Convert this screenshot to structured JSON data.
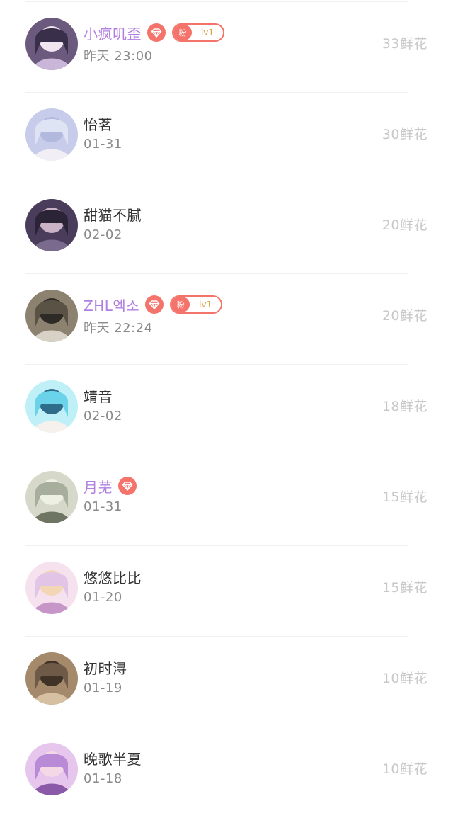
{
  "rows": [
    {
      "name": "小疯叽歪",
      "vip": true,
      "fan_badge": {
        "label": "粉",
        "level": "lv1"
      },
      "date": "昨天 23:00",
      "gift": "33鲜花",
      "avatar_icon": "anime-avatar-icon",
      "colors": [
        "#3a2f4a",
        "#6b5a7e",
        "#c9b6d8",
        "#f1e6f0"
      ]
    },
    {
      "name": "怡茗",
      "vip": false,
      "fan_badge": null,
      "date": "01-31",
      "gift": "30鲜花",
      "avatar_icon": "anime-avatar-icon",
      "colors": [
        "#dfe4f4",
        "#c6cce9",
        "#f2eef6",
        "#b2b9df"
      ]
    },
    {
      "name": "甜猫不腻",
      "vip": false,
      "fan_badge": null,
      "date": "02-02",
      "gift": "20鲜花",
      "avatar_icon": "anime-avatar-icon",
      "colors": [
        "#2b2436",
        "#4a3d5c",
        "#7a6a8e",
        "#cbb3c6"
      ]
    },
    {
      "name": "ZHL엑소",
      "vip": true,
      "fan_badge": {
        "label": "粉",
        "level": "lv1"
      },
      "date": "昨天 22:24",
      "gift": "20鲜花",
      "avatar_icon": "anime-avatar-icon",
      "colors": [
        "#5b5246",
        "#8d8270",
        "#d8d2c6",
        "#2e2a26"
      ]
    },
    {
      "name": "靖音",
      "vip": false,
      "fan_badge": null,
      "date": "02-02",
      "gift": "18鲜花",
      "avatar_icon": "anime-avatar-icon",
      "colors": [
        "#6ad3ea",
        "#bff0f8",
        "#f6f1ec",
        "#2e6c8a"
      ]
    },
    {
      "name": "月芜",
      "vip": true,
      "fan_badge": null,
      "date": "01-31",
      "gift": "15鲜花",
      "avatar_icon": "anime-avatar-icon",
      "colors": [
        "#a8ae9c",
        "#d6d9c9",
        "#6f7563",
        "#eef0e4"
      ]
    },
    {
      "name": "悠悠比比",
      "vip": false,
      "fan_badge": null,
      "date": "01-20",
      "gift": "15鲜花",
      "avatar_icon": "anime-avatar-icon",
      "colors": [
        "#e2c4e6",
        "#f6e2ef",
        "#c796c9",
        "#f3d6b4"
      ]
    },
    {
      "name": "初时浔",
      "vip": false,
      "fan_badge": null,
      "date": "01-19",
      "gift": "10鲜花",
      "avatar_icon": "portrait-avatar-icon",
      "colors": [
        "#6e5a46",
        "#a48a6a",
        "#d5c1a2",
        "#3f3226"
      ]
    },
    {
      "name": "晚歌半夏",
      "vip": false,
      "fan_badge": null,
      "date": "01-18",
      "gift": "10鲜花",
      "avatar_icon": "anime-avatar-icon",
      "colors": [
        "#b98ad6",
        "#e7c6ee",
        "#8a5aa8",
        "#f4d8e6"
      ]
    }
  ]
}
